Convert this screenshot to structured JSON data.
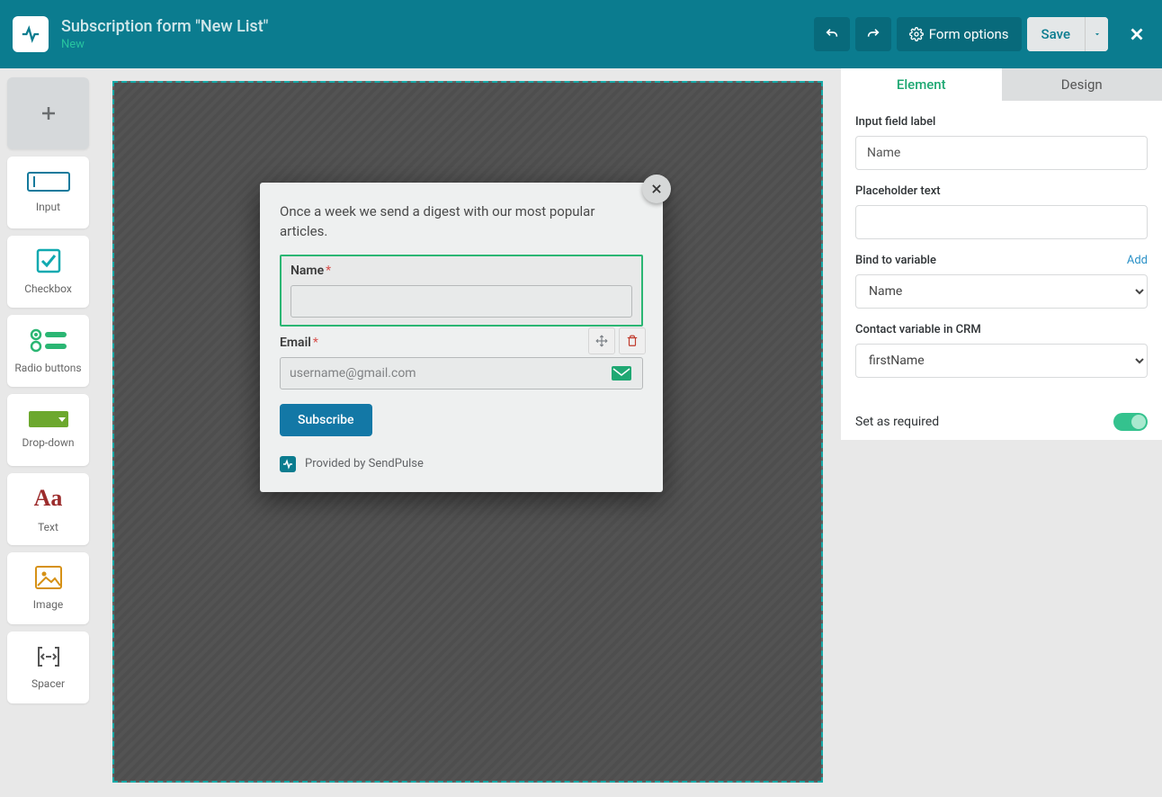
{
  "header": {
    "title": "Subscription form \"New List\"",
    "status": "New",
    "form_options": "Form options",
    "save": "Save"
  },
  "toolbox": {
    "add": "+",
    "input": "Input",
    "checkbox": "Checkbox",
    "radio": "Radio buttons",
    "dropdown": "Drop-down",
    "text": "Text",
    "image": "Image",
    "spacer": "Spacer"
  },
  "modal": {
    "description": "Once a week we send a digest with our most popular articles.",
    "name_label": "Name",
    "email_label": "Email",
    "email_placeholder": "username@gmail.com",
    "subscribe": "Subscribe",
    "provided": "Provided by SendPulse"
  },
  "panel": {
    "tabs": {
      "element": "Element",
      "design": "Design"
    },
    "input_field_label": "Input field label",
    "input_field_value": "Name",
    "placeholder_text": "Placeholder text",
    "placeholder_value": "",
    "bind_to_variable": "Bind to variable",
    "add": "Add",
    "bind_value": "Name",
    "crm_label": "Contact variable in CRM",
    "crm_value": "firstName",
    "set_required": "Set as required"
  }
}
